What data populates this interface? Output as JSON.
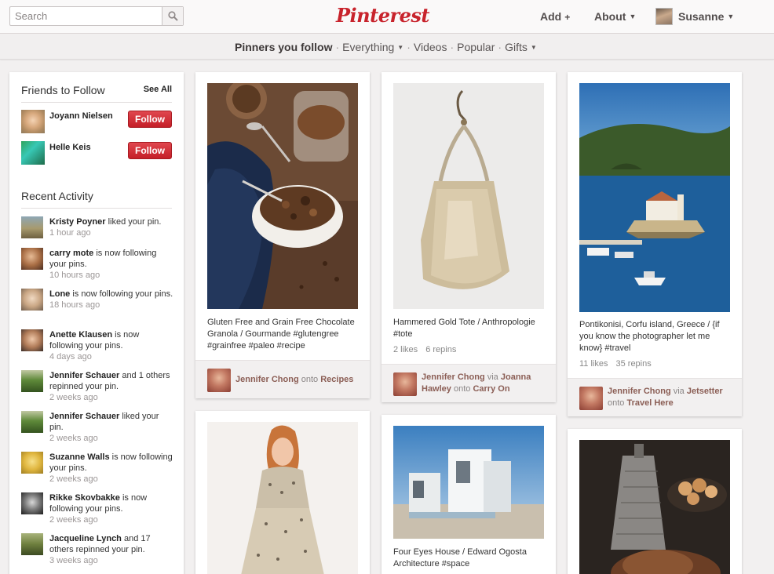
{
  "header": {
    "search_placeholder": "Search",
    "logo": "Pinterest",
    "add_label": "Add",
    "about_label": "About",
    "user_name": "Susanne"
  },
  "subnav": {
    "items": [
      "Pinners you follow",
      "Everything",
      "Videos",
      "Popular",
      "Gifts"
    ]
  },
  "sidebar": {
    "friends_title": "Friends to Follow",
    "see_all": "See All",
    "friends": [
      {
        "name": "Joyann Nielsen",
        "button": "Follow"
      },
      {
        "name": "Helle Keis",
        "button": "Follow"
      }
    ],
    "activity_title": "Recent Activity",
    "activity": [
      {
        "name": "Kristy Poyner",
        "text": " liked your pin.",
        "time": "1 hour ago"
      },
      {
        "name": "carry mote",
        "text": " is now following your pins.",
        "time": "10 hours ago"
      },
      {
        "name": "Lone",
        "text": " is now following your pins.",
        "time": "18 hours ago"
      },
      {
        "name": "Anette Klausen",
        "text": " is now following your pins.",
        "time": "4 days ago"
      },
      {
        "name": "Jennifer Schauer",
        "text": " and 1 others repinned your pin.",
        "time": "2 weeks ago"
      },
      {
        "name": "Jennifer Schauer",
        "text": " liked your pin.",
        "time": "2 weeks ago"
      },
      {
        "name": "Suzanne Walls",
        "text": " is now following your pins.",
        "time": "2 weeks ago"
      },
      {
        "name": "Rikke Skovbakke",
        "text": " is now following your pins.",
        "time": "2 weeks ago"
      },
      {
        "name": "Jacqueline Lynch",
        "text": " and 17 others repinned your pin.",
        "time": "3 weeks ago"
      }
    ]
  },
  "pins": [
    {
      "description": "Gluten Free and Grain Free Chocolate Granola / Gourmande #glutengree #grainfree #paleo #recipe",
      "pinner": "Jennifer Chong",
      "onto_word": "onto",
      "board": "Recipes"
    },
    {
      "description": "Hammered Gold Tote / Anthropologie #tote",
      "likes": "2 likes",
      "repins": "6 repins",
      "pinner": "Jennifer Chong",
      "via_word": "via",
      "via": "Joanna Hawley",
      "onto_word": "onto",
      "board": "Carry On"
    },
    {
      "description": "Pontikonisi, Corfu island, Greece / {if you know the photographer let me know} #travel",
      "likes": "11 likes",
      "repins": "35 repins",
      "pinner": "Jennifer Chong",
      "via_word": "via",
      "via": "Jetsetter",
      "onto_word": "onto",
      "board": "Travel Here"
    },
    {
      "description": ""
    },
    {
      "description": "Four Eyes House / Edward Ogosta Architecture #space"
    },
    {
      "description": ""
    }
  ]
}
